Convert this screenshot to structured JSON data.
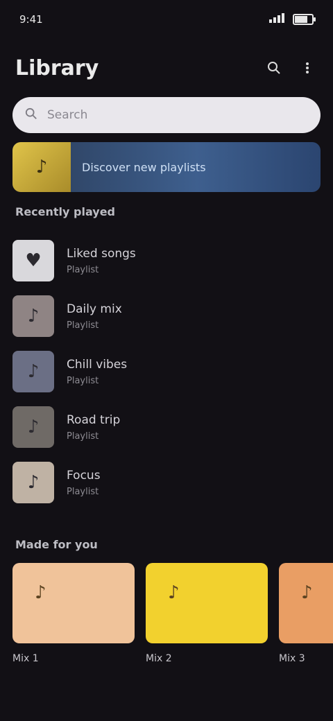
{
  "status": {
    "time": "9:41",
    "battery_level": 0.8
  },
  "header": {
    "title": "Library",
    "actions": [
      "search-icon",
      "menu-icon"
    ]
  },
  "search": {
    "placeholder": "Search"
  },
  "banner": {
    "text": "Discover new playlists"
  },
  "sections": {
    "recent_title": "Recently played",
    "featured_title": "Made for you"
  },
  "list": [
    {
      "title": "Liked songs",
      "subtitle": "Playlist",
      "color": "#d9d8dc",
      "icon": "heart-icon"
    },
    {
      "title": "Daily mix",
      "subtitle": "Playlist",
      "color": "#8f8484",
      "icon": "music-icon"
    },
    {
      "title": "Chill vibes",
      "subtitle": "Playlist",
      "color": "#6b6f85",
      "icon": "music-icon"
    },
    {
      "title": "Road trip",
      "subtitle": "Playlist",
      "color": "#6f6a66",
      "icon": "music-icon"
    },
    {
      "title": "Focus",
      "subtitle": "Playlist",
      "color": "#bfb2a4",
      "icon": "music-icon"
    }
  ],
  "cards": [
    {
      "title": "Mix 1",
      "color": "#f0c39a",
      "icon": "music-icon"
    },
    {
      "title": "Mix 2",
      "color": "#f2d12e",
      "icon": "music-icon"
    },
    {
      "title": "Mix 3",
      "color": "#e99e64",
      "icon": "music-icon"
    }
  ]
}
